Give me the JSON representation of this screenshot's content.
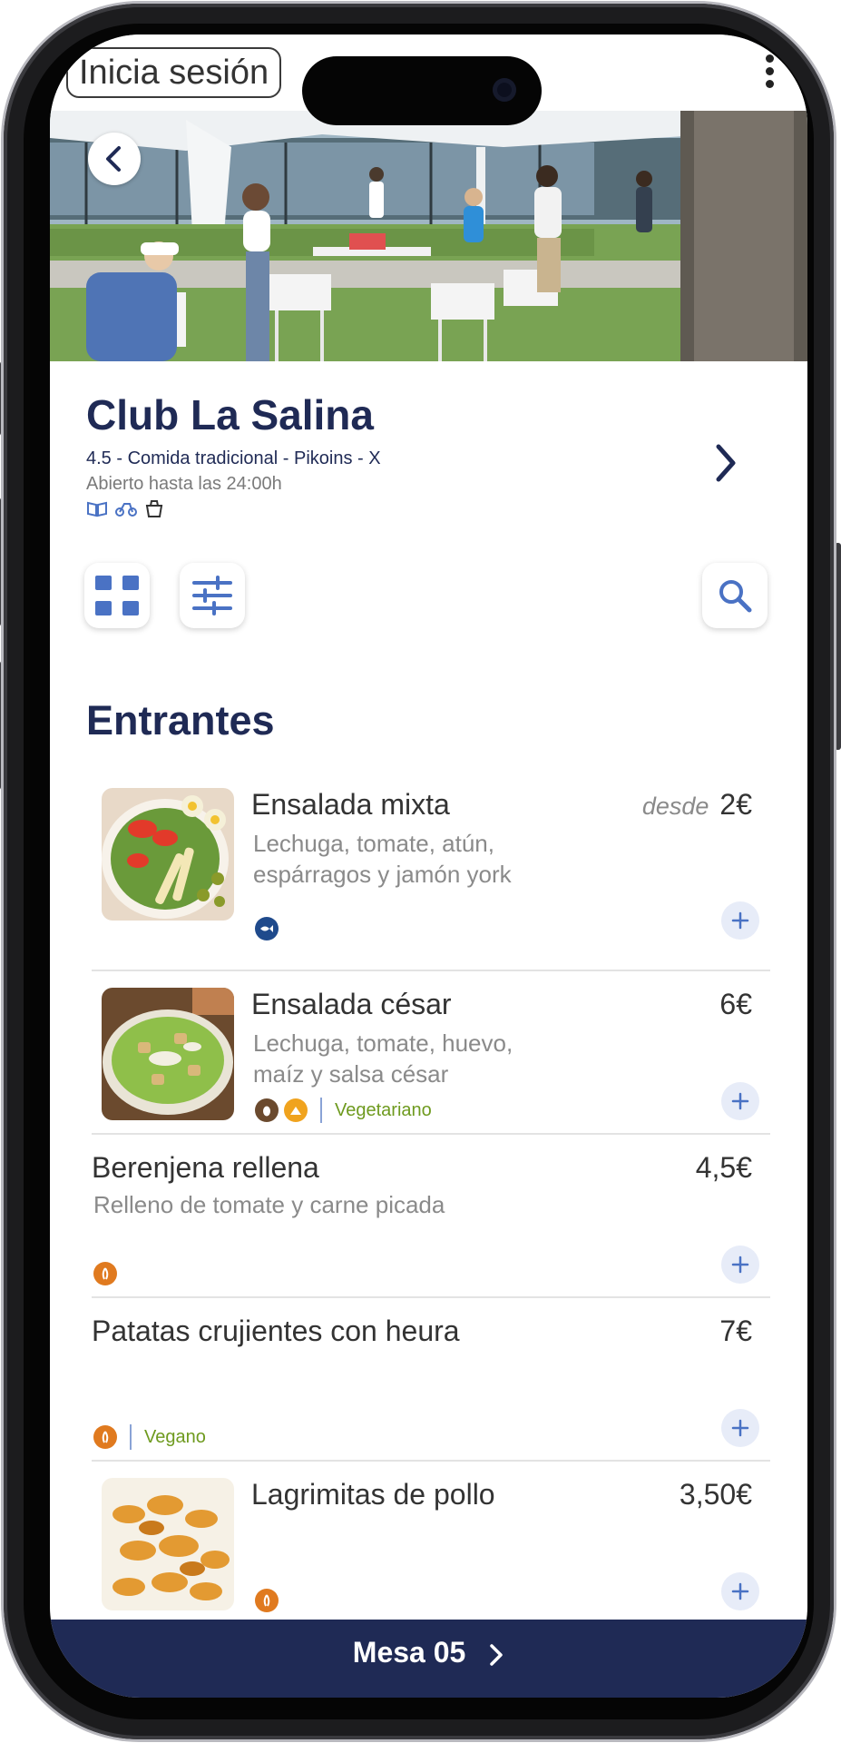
{
  "topbar": {
    "login_label": "Inicia sesión"
  },
  "restaurant": {
    "name": "Club La Salina",
    "meta": "4.5 - Comida tradicional - Pikoins - X",
    "hours": "Abierto hasta las 24:00h",
    "service_icons": [
      "menu-book-icon",
      "bike-delivery-icon",
      "takeaway-bag-icon"
    ]
  },
  "toolbar": {
    "icons": [
      "grid-view-icon",
      "filter-sliders-icon",
      "search-icon"
    ]
  },
  "section": {
    "title": "Entrantes"
  },
  "items": [
    {
      "name": "Ensalada mixta",
      "desc": "Lechuga, tomate, atún, espárragos y jamón york",
      "price_prefix": "desde",
      "price": "2€",
      "allergens": [
        "fish-allergen-icon"
      ],
      "diet": ""
    },
    {
      "name": "Ensalada césar",
      "desc": "Lechuga, tomate, huevo, maíz y salsa césar",
      "price_prefix": "",
      "price": "6€",
      "allergens": [
        "egg-allergen-icon",
        "dairy-allergen-icon"
      ],
      "diet": "Vegetariano"
    },
    {
      "name": "Berenjena rellena",
      "desc": "Relleno de tomate y carne picada",
      "price_prefix": "",
      "price": "4,5€",
      "allergens": [
        "gluten-allergen-icon"
      ],
      "diet": ""
    },
    {
      "name": "Patatas crujientes con heura",
      "desc": "",
      "price_prefix": "",
      "price": "7€",
      "allergens": [
        "gluten-allergen-icon"
      ],
      "diet": "Vegano"
    },
    {
      "name": "Lagrimitas de pollo",
      "desc": "",
      "price_prefix": "",
      "price": "3,50€",
      "allergens": [
        "gluten-allergen-icon"
      ],
      "diet": ""
    }
  ],
  "bottom_bar": {
    "label": "Mesa 05"
  },
  "colors": {
    "brand": "#1f2a55",
    "accent": "#4a72c4",
    "vegetarian": "#6e9a1e",
    "allergen_orange": "#e07a1f"
  }
}
